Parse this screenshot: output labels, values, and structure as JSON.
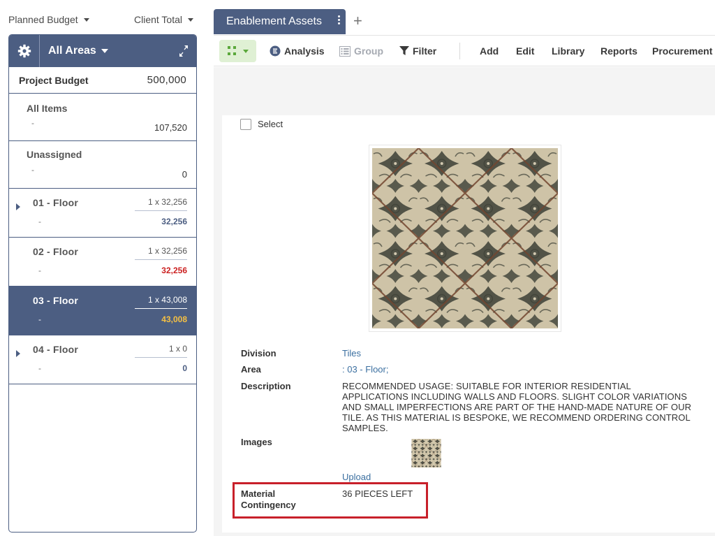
{
  "top": {
    "planned_budget": "Planned Budget",
    "client_total": "Client Total"
  },
  "sidebar": {
    "areas_label": "All Areas",
    "project_budget_label": "Project Budget",
    "project_budget_value": "500,000",
    "all_items": {
      "label": "All Items",
      "dash": "-",
      "value": "107,520"
    },
    "unassigned": {
      "label": "Unassigned",
      "dash": "-",
      "value": "0"
    },
    "floors": [
      {
        "label": "01 - Floor",
        "qty": "1 x 32,256",
        "dash": "-",
        "subtotal": "32,256",
        "expandable": true,
        "state": "normal"
      },
      {
        "label": "02 - Floor",
        "qty": "1 x 32,256",
        "dash": "-",
        "subtotal": "32,256",
        "expandable": false,
        "state": "over"
      },
      {
        "label": "03 - Floor",
        "qty": "1 x 43,008",
        "dash": "-",
        "subtotal": "43,008",
        "expandable": false,
        "state": "active"
      },
      {
        "label": "04 - Floor",
        "qty": "1 x 0",
        "dash": "-",
        "subtotal": "0",
        "expandable": true,
        "state": "normal"
      }
    ]
  },
  "tabs": [
    {
      "label": "Enablement Assets",
      "active": true
    }
  ],
  "toolbar": {
    "analysis": "Analysis",
    "group": "Group",
    "filter": "Filter",
    "add": "Add",
    "edit": "Edit",
    "library": "Library",
    "reports": "Reports",
    "procurement": "Procurement"
  },
  "detail": {
    "select_label": "Select",
    "division_label": "Division",
    "division_value": "Tiles",
    "area_label": "Area",
    "area_value": ": 03 - Floor;",
    "description_label": "Description",
    "description_value": "RECOMMENDED USAGE: SUITABLE FOR INTERIOR RESIDENTIAL APPLICATIONS INCLUDING WALLS AND FLOORS. SLIGHT COLOR VARIATIONS AND SMALL IMPERFECTIONS ARE PART OF THE HAND-MADE NATURE OF OUR TILE. AS THIS MATERIAL IS BESPOKE, WE RECOMMEND ORDERING CONTROL SAMPLES.",
    "images_label": "Images",
    "upload_label": "Upload",
    "contingency_label_line1": "Material",
    "contingency_label_line2": "Contingency",
    "contingency_value": "36 PIECES LEFT"
  },
  "colors": {
    "primary": "#4c5e82",
    "accent_yellow": "#f5c043",
    "over_budget_red": "#cc2222",
    "highlight_red": "#c8202a",
    "grid_button_bg": "#dff0d4",
    "link_blue": "#3b6fa0"
  },
  "icons": {
    "gear": "gear-icon",
    "expand": "expand-arrows-icon",
    "analysis": "analysis-circle-icon",
    "group": "group-list-icon",
    "filter": "filter-funnel-icon",
    "grid": "grid-view-icon"
  }
}
